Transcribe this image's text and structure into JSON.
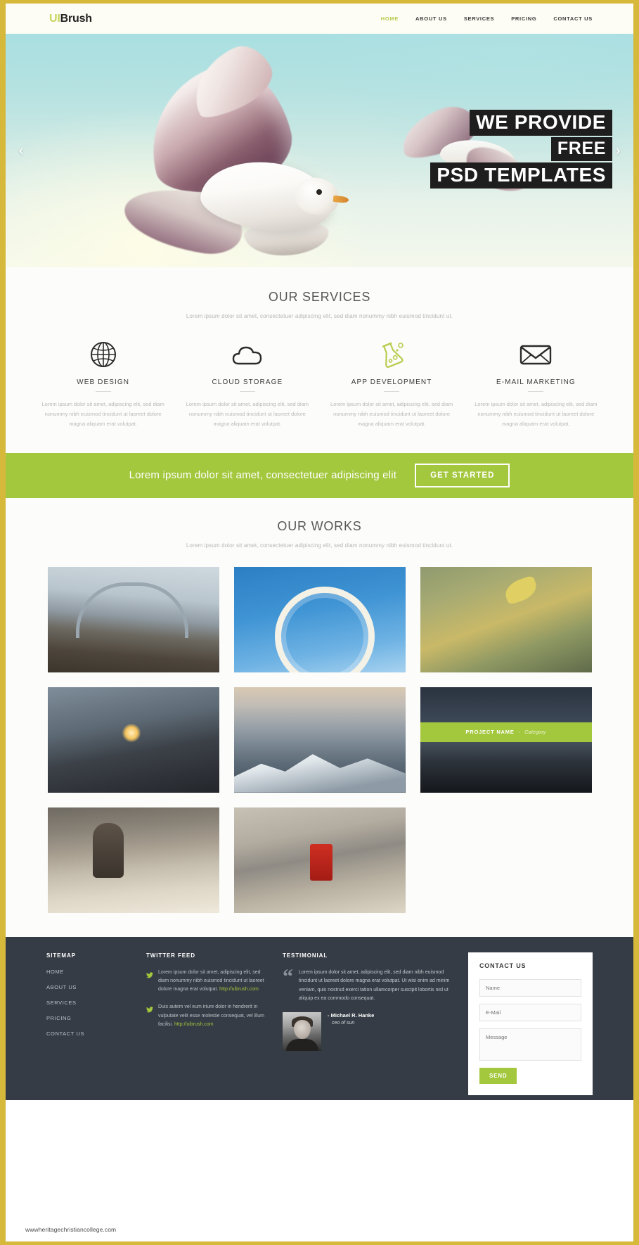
{
  "header": {
    "logo_ui": "UI",
    "logo_brush": "Brush",
    "nav": [
      {
        "label": "HOME",
        "active": true
      },
      {
        "label": "ABOUT US",
        "active": false
      },
      {
        "label": "SERVICES",
        "active": false
      },
      {
        "label": "PRICING",
        "active": false
      },
      {
        "label": "CONTACT US",
        "active": false
      }
    ]
  },
  "hero": {
    "line1": "WE PROVIDE",
    "line2": "FREE",
    "line3": "PSD TEMPLATES",
    "prev_arrow": "‹",
    "next_arrow": "›"
  },
  "services": {
    "title": "OUR SERVICES",
    "subtitle": "Lorem ipsum dolor sit amet, consectetuer adipiscing elit, sed diam nonummy nibh euismod tincidunt ut.",
    "items": [
      {
        "icon": "globe-icon",
        "name": "WEB DESIGN",
        "desc": "Lorem ipsum dolor sit amet,  adipiscing elit, sed diam nonummy nibh euismod tincidunt ut laoreet dolore magna aliquam erat volutpat."
      },
      {
        "icon": "cloud-icon",
        "name": "CLOUD STORAGE",
        "desc": "Lorem ipsum dolor sit amet,  adipiscing elit, sed diam nonummy nibh euismod tincidunt ut laoreet dolore magna aliquam erat volutpat."
      },
      {
        "icon": "flask-icon",
        "name": "APP DEVELOPMENT",
        "desc": "Lorem ipsum dolor sit amet,  adipiscing elit, sed diam nonummy nibh euismod tincidunt ut laoreet dolore magna aliquam erat volutpat."
      },
      {
        "icon": "envelope-icon",
        "name": "E-MAIL MARKETING",
        "desc": "Lorem ipsum dolor sit amet,  adipiscing elit, sed diam nonummy nibh euismod tincidunt ut laoreet dolore magna aliquam erat volutpat."
      }
    ]
  },
  "cta": {
    "text": "Lorem ipsum dolor sit amet, consectetuer adipiscing elit",
    "button": "GET STARTED",
    "bg_color": "#a3c73d"
  },
  "works": {
    "title": "OUR WORKS",
    "subtitle": "Lorem ipsum dolor sit amet, consectetuer adipiscing elit, sed diam nonummy nibh euismod tincidunt ut.",
    "overlay": {
      "project_name": "PROJECT NAME",
      "separator": "-",
      "category": "Category"
    }
  },
  "footer": {
    "sitemap": {
      "title": "SITEMAP",
      "links": [
        "HOME",
        "ABOUT US",
        "SERVICES",
        "PRICING",
        "CONTACT US"
      ]
    },
    "twitter": {
      "title": "TWITTER FEED",
      "tweets": [
        {
          "text": "Lorem ipsum dolor sit amet,  adipiscing elit, sed diam nonummy nibh euismod tincidunt ut laoreet dolore magna erat volutpat. ",
          "link": "http://uibrush.com"
        },
        {
          "text": "Duis autem vel eum iriure dolor in hendrerit in vulputate velit esse molestie consequat, vel illum facilisi. ",
          "link": "http://uibrush.com"
        }
      ]
    },
    "testimonial": {
      "title": "TESTIMONIAL",
      "quote_mark": "“",
      "quote": "Lorem ipsum dolor sit amet,  adipiscing elit, sed diam  nibh euismod tincidunt ut laoreet dolore magna erat volutpat. Ut wisi enim ad minim veniam, quis nostrud exerci tation ullamcorper suscipit lobortis nisl ut aliquip ex ea commodo consequat.",
      "author": "- Michael R. Hanke",
      "role": "ceo of sun"
    },
    "contact": {
      "title": "CONTACT US",
      "name_placeholder": "Name",
      "email_placeholder": "E-Mail",
      "message_placeholder": "Message",
      "send_label": "SEND",
      "name_value": "",
      "email_value": "",
      "message_value": ""
    }
  },
  "watermark": "wwwheritagechristiancollege.com"
}
